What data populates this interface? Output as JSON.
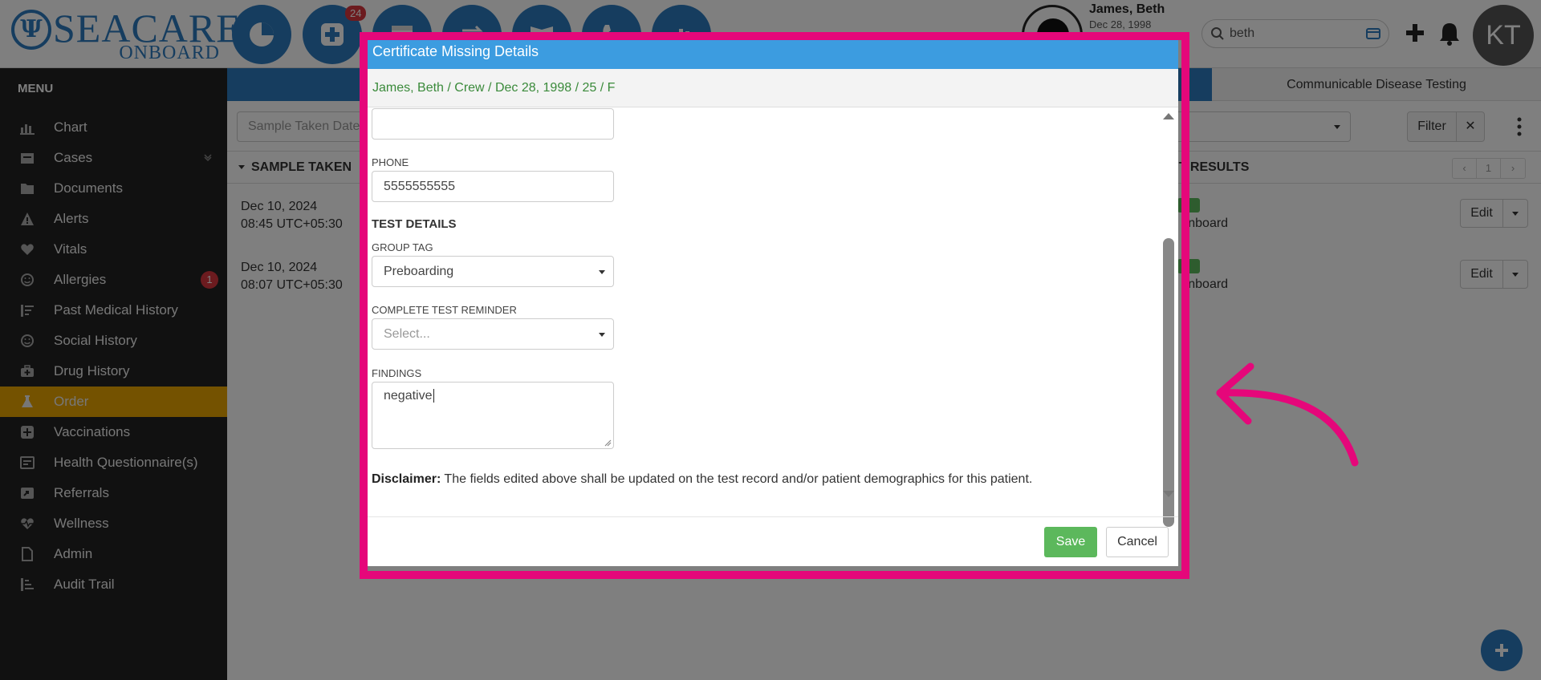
{
  "header": {
    "logo_text": "SEACARE",
    "logo_sub": "ONBOARD",
    "action_badge": "24",
    "patient_name": "James, Beth",
    "patient_dob": "Dec 28, 1998",
    "search_value": "beth",
    "user_initials": "KT"
  },
  "sidebar": {
    "title": "MENU",
    "items": [
      {
        "label": "Chart",
        "icon": "bar-chart-icon"
      },
      {
        "label": "Cases",
        "icon": "cases-icon"
      },
      {
        "label": "Documents",
        "icon": "folder-icon"
      },
      {
        "label": "Alerts",
        "icon": "warning-icon"
      },
      {
        "label": "Vitals",
        "icon": "heart-icon"
      },
      {
        "label": "Allergies",
        "icon": "smiley-icon",
        "badge": "1"
      },
      {
        "label": "Past Medical History",
        "icon": "history-list-icon"
      },
      {
        "label": "Social History",
        "icon": "smiley-icon"
      },
      {
        "label": "Drug History",
        "icon": "medkit-icon"
      },
      {
        "label": "Order",
        "icon": "flask-icon",
        "active": true
      },
      {
        "label": "Vaccinations",
        "icon": "plus-square-icon"
      },
      {
        "label": "Health Questionnaire(s)",
        "icon": "form-icon"
      },
      {
        "label": "Referrals",
        "icon": "referral-icon"
      },
      {
        "label": "Wellness",
        "icon": "heartbeat-icon"
      },
      {
        "label": "Admin",
        "icon": "file-icon"
      },
      {
        "label": "Audit Trail",
        "icon": "audit-icon"
      }
    ]
  },
  "main": {
    "tab_right": "Communicable Disease Testing",
    "date_placeholder": "Sample Taken Date",
    "filter_label": "Filter",
    "clear_label": "✕",
    "col_sample": "SAMPLE TAKEN",
    "col_results": "ST RESULTS",
    "page_number": "1",
    "rows": [
      {
        "date": "Dec 10, 2024",
        "time": "08:45 UTC+05:30",
        "result": "e onboard",
        "edit": "Edit"
      },
      {
        "date": "Dec 10, 2024",
        "time": "08:07 UTC+05:30",
        "result": "e onboard",
        "edit": "Edit"
      }
    ]
  },
  "modal": {
    "title": "Certificate Missing Details",
    "subtitle": "James, Beth / Crew / Dec 28, 1998 / 25 / F",
    "phone_label": "PHONE",
    "phone_value": "5555555555",
    "section_title": "TEST DETAILS",
    "group_tag_label": "GROUP TAG",
    "group_tag_value": "Preboarding",
    "reminder_label": "COMPLETE TEST REMINDER",
    "reminder_placeholder": "Select...",
    "findings_label": "FINDINGS",
    "findings_value": "negative",
    "disclaimer_label": "Disclaimer:",
    "disclaimer_text": " The fields edited above shall be updated on the test record and/or patient demographics for this patient.",
    "save_label": "Save",
    "cancel_label": "Cancel"
  },
  "colors": {
    "brand_blue": "#2d7bbf",
    "modal_header": "#3c9ce0",
    "highlight": "#e5077a",
    "active_nav": "#e8a400",
    "save_green": "#5cb85c"
  }
}
